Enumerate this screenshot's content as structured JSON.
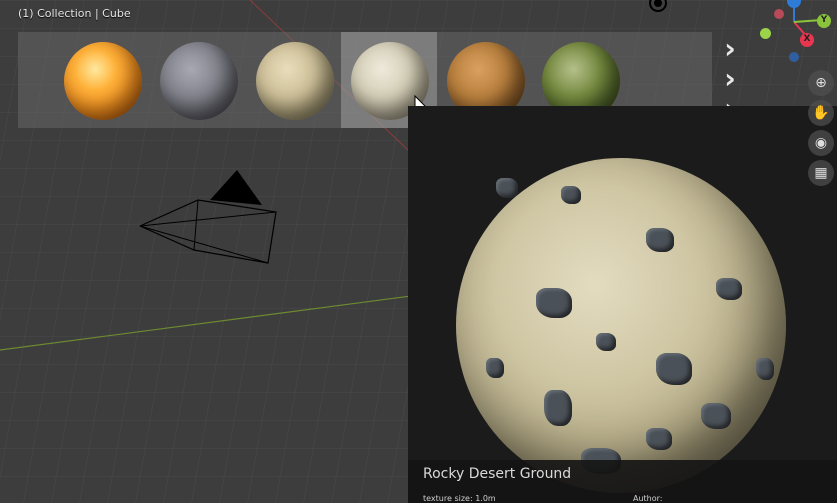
{
  "viewport": {
    "title": "(1) Collection | Cube"
  },
  "gizmo": {
    "z_label": "Z",
    "x_label": "X",
    "y_label": "Y",
    "colors": {
      "x": "#e8364f",
      "y": "#8bc43a",
      "z": "#2e7cd8"
    }
  },
  "materials": [
    {
      "name": "lava-material",
      "icon": "sphere-thumbnail"
    },
    {
      "name": "granite-material",
      "icon": "sphere-thumbnail"
    },
    {
      "name": "sandstone-material",
      "icon": "sphere-thumbnail"
    },
    {
      "name": "rocky-desert-material",
      "icon": "sphere-thumbnail",
      "selected": true
    },
    {
      "name": "gravel-material",
      "icon": "sphere-thumbnail"
    },
    {
      "name": "mossy-material",
      "icon": "sphere-thumbnail"
    }
  ],
  "nav": {
    "next_icon": "chevron-right-icon",
    "zoom_icon": "zoom-icon"
  },
  "preview": {
    "name": "Rocky Desert Ground",
    "texture_size": "texture size: 1.0m",
    "author": "Author:"
  }
}
